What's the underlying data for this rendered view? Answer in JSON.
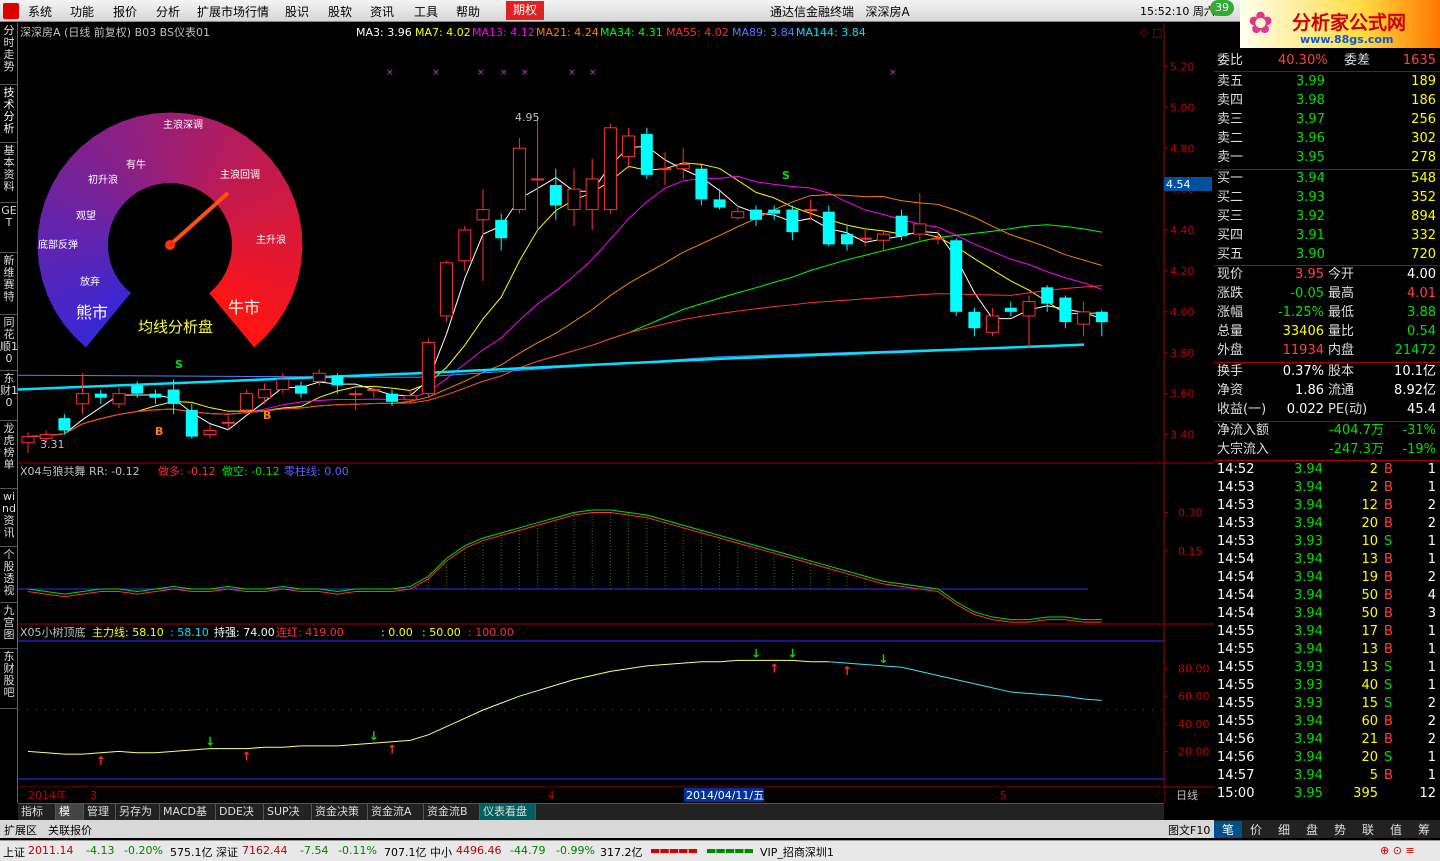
{
  "menu": {
    "items": [
      "系统",
      "功能",
      "报价",
      "分析",
      "扩展市场行情",
      "股识",
      "股软",
      "资讯",
      "工具",
      "帮助"
    ],
    "options_tab": "期权",
    "app_title": "通达信金融终端",
    "stock_name": "深深房A",
    "time": "15:52:10 周六",
    "badge": "39"
  },
  "brand": {
    "title": "分析家公式网",
    "url": "www.88gs.com"
  },
  "left_tabs": [
    "分时走势",
    "技术分析",
    "基本资料",
    "GET",
    "新维赛特",
    "同花顺10",
    "东财10",
    "龙虎榜单",
    "wind资讯",
    "个股透视",
    "九宫图",
    "东财股吧"
  ],
  "chart": {
    "header": "深深房A (日线 前复权) B03 BS仪表01",
    "ma_labels": [
      {
        "t": "MA3: 3.96",
        "c": "#ffffff"
      },
      {
        "t": "MA7: 4.02",
        "c": "#ffff00"
      },
      {
        "t": "MA13: 4.12",
        "c": "#ff00ff"
      },
      {
        "t": "MA21: 4.24",
        "c": "#ff8000"
      },
      {
        "t": "MA34: 4.31",
        "c": "#00ff00"
      },
      {
        "t": "MA55: 4.02",
        "c": "#ff3030"
      },
      {
        "t": "MA89: 3.84",
        "c": "#5080ff"
      },
      {
        "t": "MA144: 3.84",
        "c": "#00e0ff"
      }
    ],
    "price_ticks": [
      "5.20",
      "5.00",
      "4.80",
      "4.60",
      "4.40",
      "4.20",
      "4.00",
      "3.80",
      "3.60",
      "3.40"
    ],
    "current_price_tag": "4.54",
    "high_label": "4.95",
    "low_label": "3.31",
    "gauge": {
      "title": "均线分析盘",
      "labels": [
        "底部反弹",
        "观望",
        "初升浪",
        "有牛",
        "主浪深调",
        "主浪回调",
        "主升浪",
        "熊市",
        "牛市",
        "放弃"
      ]
    },
    "signals": [
      "S",
      "S",
      "B",
      "B"
    ],
    "ind1": {
      "header": "X04与狼共舞",
      "rr": "RR: -0.12",
      "a": "做多: -0.12",
      "b": "做空: -0.12",
      "c": "零柱线: 0.00",
      "ticks": [
        "0.30",
        "0.15"
      ]
    },
    "ind2": {
      "header": "X05小树顶底",
      "a": "主力线: 58.10",
      "b": ": 58.10",
      "c": "持强: 74.00",
      "d": "连红: 419.00",
      "e": ": 0.00",
      "f": ": 50.00",
      "g": ": 100.00",
      "ticks": [
        "80.00",
        "60.00",
        "40.00",
        "20.00"
      ]
    },
    "xaxis": {
      "year": "2014年",
      "m3": "3",
      "m4": "4",
      "date": "2014/04/11/五",
      "m5": "5",
      "period": "日线"
    }
  },
  "chart_data": {
    "type": "candlestick",
    "title": "深深房A (日线 前复权)",
    "ylim": [
      3.3,
      5.3
    ],
    "candles": [
      [
        3.36,
        3.39,
        3.41,
        3.31
      ],
      [
        3.38,
        3.4,
        3.42,
        3.36
      ],
      [
        3.48,
        3.42,
        3.5,
        3.4
      ],
      [
        3.55,
        3.6,
        3.7,
        3.5
      ],
      [
        3.6,
        3.58,
        3.62,
        3.55
      ],
      [
        3.55,
        3.6,
        3.63,
        3.53
      ],
      [
        3.64,
        3.6,
        3.66,
        3.58
      ],
      [
        3.6,
        3.58,
        3.62,
        3.55
      ],
      [
        3.62,
        3.55,
        3.67,
        3.5
      ],
      [
        3.52,
        3.39,
        3.55,
        3.38
      ],
      [
        3.4,
        3.42,
        3.45,
        3.38
      ],
      [
        3.46,
        3.46,
        3.5,
        3.42
      ],
      [
        3.52,
        3.6,
        3.62,
        3.5
      ],
      [
        3.58,
        3.62,
        3.65,
        3.55
      ],
      [
        3.62,
        3.67,
        3.7,
        3.6
      ],
      [
        3.64,
        3.6,
        3.66,
        3.58
      ],
      [
        3.66,
        3.7,
        3.72,
        3.64
      ],
      [
        3.69,
        3.64,
        3.7,
        3.6
      ],
      [
        3.6,
        3.6,
        3.62,
        3.52
      ],
      [
        3.62,
        3.62,
        3.64,
        3.58
      ],
      [
        3.6,
        3.56,
        3.62,
        3.54
      ],
      [
        3.57,
        3.59,
        3.62,
        3.55
      ],
      [
        3.6,
        3.85,
        3.87,
        3.58
      ],
      [
        3.98,
        4.24,
        4.25,
        3.95
      ],
      [
        4.25,
        4.4,
        4.42,
        4.2
      ],
      [
        4.45,
        4.5,
        4.6,
        4.15
      ],
      [
        4.45,
        4.36,
        4.48,
        4.3
      ],
      [
        4.5,
        4.8,
        4.85,
        4.48
      ],
      [
        4.65,
        4.65,
        4.95,
        4.4
      ],
      [
        4.62,
        4.52,
        4.7,
        4.45
      ],
      [
        4.5,
        4.6,
        4.7,
        4.42
      ],
      [
        4.5,
        4.65,
        4.75,
        4.4
      ],
      [
        4.5,
        4.9,
        4.92,
        4.48
      ],
      [
        4.76,
        4.86,
        4.9,
        4.7
      ],
      [
        4.87,
        4.67,
        4.9,
        4.65
      ],
      [
        4.7,
        4.7,
        4.78,
        4.62
      ],
      [
        4.7,
        4.72,
        4.8,
        4.65
      ],
      [
        4.7,
        4.55,
        4.72,
        4.52
      ],
      [
        4.55,
        4.51,
        4.6,
        4.5
      ],
      [
        4.46,
        4.49,
        4.52,
        4.45
      ],
      [
        4.5,
        4.45,
        4.52,
        4.42
      ],
      [
        4.5,
        4.48,
        4.52,
        4.45
      ],
      [
        4.5,
        4.39,
        4.52,
        4.35
      ],
      [
        4.5,
        4.5,
        4.55,
        4.45
      ],
      [
        4.49,
        4.33,
        4.52,
        4.32
      ],
      [
        4.38,
        4.33,
        4.42,
        4.3
      ],
      [
        4.36,
        4.36,
        4.4,
        4.32
      ],
      [
        4.35,
        4.38,
        4.4,
        4.3
      ],
      [
        4.47,
        4.37,
        4.5,
        4.35
      ],
      [
        4.38,
        4.43,
        4.58,
        4.35
      ],
      [
        4.36,
        4.36,
        4.4,
        4.33
      ],
      [
        4.35,
        4.0,
        4.36,
        3.98
      ],
      [
        4.0,
        3.92,
        4.02,
        3.88
      ],
      [
        3.9,
        3.98,
        4.02,
        3.88
      ],
      [
        4.02,
        4.0,
        4.05,
        3.98
      ],
      [
        3.98,
        4.05,
        4.08,
        3.82
      ],
      [
        4.12,
        4.04,
        4.13,
        4.0
      ],
      [
        4.07,
        3.95,
        4.08,
        3.92
      ],
      [
        3.94,
        4.0,
        4.05,
        3.88
      ],
      [
        4.0,
        3.95,
        4.01,
        3.88
      ]
    ]
  },
  "quote": {
    "ratio_label": "委比",
    "ratio": "40.30%",
    "diff_label": "委差",
    "diff": "1635",
    "asks": [
      {
        "l": "卖五",
        "p": "3.99",
        "v": "189"
      },
      {
        "l": "卖四",
        "p": "3.98",
        "v": "186"
      },
      {
        "l": "卖三",
        "p": "3.97",
        "v": "256"
      },
      {
        "l": "卖二",
        "p": "3.96",
        "v": "302"
      },
      {
        "l": "卖一",
        "p": "3.95",
        "v": "278"
      }
    ],
    "bids": [
      {
        "l": "买一",
        "p": "3.94",
        "v": "548"
      },
      {
        "l": "买二",
        "p": "3.93",
        "v": "352"
      },
      {
        "l": "买三",
        "p": "3.92",
        "v": "894"
      },
      {
        "l": "买四",
        "p": "3.91",
        "v": "332"
      },
      {
        "l": "买五",
        "p": "3.90",
        "v": "720"
      }
    ],
    "stats": [
      {
        "a": "现价",
        "av": "3.95",
        "ac": "#ff4040",
        "b": "今开",
        "bv": "4.00",
        "bc": "#ffffff"
      },
      {
        "a": "涨跌",
        "av": "-0.05",
        "ac": "#00e000",
        "b": "最高",
        "bv": "4.01",
        "bc": "#ff4040"
      },
      {
        "a": "涨幅",
        "av": "-1.25%",
        "ac": "#00e000",
        "b": "最低",
        "bv": "3.88",
        "bc": "#00e000"
      },
      {
        "a": "总量",
        "av": "33406",
        "ac": "#ffff00",
        "b": "量比",
        "bv": "0.54",
        "bc": "#00e000"
      },
      {
        "a": "外盘",
        "av": "11934",
        "ac": "#ff4040",
        "b": "内盘",
        "bv": "21472",
        "bc": "#00e000"
      }
    ],
    "stats2": [
      {
        "a": "换手",
        "av": "0.37%",
        "b": "股本",
        "bv": "10.1亿"
      },
      {
        "a": "净资",
        "av": "1.86",
        "b": "流通",
        "bv": "8.92亿"
      },
      {
        "a": "收益(一)",
        "av": "0.022",
        "b": "PE(动)",
        "bv": "45.4"
      }
    ],
    "flows": [
      {
        "l": "净流入额",
        "v": "-404.7万",
        "p": "-31%"
      },
      {
        "l": "大宗流入",
        "v": "-247.3万",
        "p": "-19%"
      }
    ],
    "ticks": [
      {
        "t": "14:52",
        "p": "3.94",
        "v": "2",
        "s": "B",
        "n": "1"
      },
      {
        "t": "14:53",
        "p": "3.94",
        "v": "2",
        "s": "B",
        "n": "1"
      },
      {
        "t": "14:53",
        "p": "3.94",
        "v": "12",
        "s": "B",
        "n": "2"
      },
      {
        "t": "14:53",
        "p": "3.94",
        "v": "20",
        "s": "B",
        "n": "2"
      },
      {
        "t": "14:53",
        "p": "3.93",
        "v": "10",
        "s": "S",
        "n": "1"
      },
      {
        "t": "14:54",
        "p": "3.94",
        "v": "13",
        "s": "B",
        "n": "1"
      },
      {
        "t": "14:54",
        "p": "3.94",
        "v": "19",
        "s": "B",
        "n": "2"
      },
      {
        "t": "14:54",
        "p": "3.94",
        "v": "50",
        "s": "B",
        "n": "4"
      },
      {
        "t": "14:54",
        "p": "3.94",
        "v": "50",
        "s": "B",
        "n": "3"
      },
      {
        "t": "14:55",
        "p": "3.94",
        "v": "17",
        "s": "B",
        "n": "1"
      },
      {
        "t": "14:55",
        "p": "3.94",
        "v": "13",
        "s": "B",
        "n": "1"
      },
      {
        "t": "14:55",
        "p": "3.93",
        "v": "13",
        "s": "S",
        "n": "1"
      },
      {
        "t": "14:55",
        "p": "3.93",
        "v": "40",
        "s": "S",
        "n": "1"
      },
      {
        "t": "14:55",
        "p": "3.93",
        "v": "15",
        "s": "S",
        "n": "2"
      },
      {
        "t": "14:55",
        "p": "3.94",
        "v": "60",
        "s": "B",
        "n": "2"
      },
      {
        "t": "14:56",
        "p": "3.94",
        "v": "21",
        "s": "B",
        "n": "2"
      },
      {
        "t": "14:56",
        "p": "3.94",
        "v": "20",
        "s": "S",
        "n": "1"
      },
      {
        "t": "14:57",
        "p": "3.94",
        "v": "5",
        "s": "B",
        "n": "1"
      },
      {
        "t": "15:00",
        "p": "3.95",
        "v": "395",
        "s": "",
        "n": "12"
      }
    ]
  },
  "bottom_tabs": [
    "指标",
    "模板",
    "管理",
    "另存为",
    "MACD基本",
    "DDE决策",
    "SUP决策",
    "资金决策",
    "资金流A",
    "资金流B",
    "仪表看盘"
  ],
  "row2": {
    "a": "扩展区",
    "b": "关联报价",
    "c": "图文F10"
  },
  "right_tabs": [
    "笔",
    "价",
    "细",
    "盘",
    "势",
    "联",
    "值",
    "筹"
  ],
  "status": {
    "sh": "上证",
    "sh_v": "2011.14",
    "sh_c": "-4.13",
    "sh_p": "-0.20%",
    "sh_a": "575.1亿",
    "sz": "深证",
    "sz_v": "7162.44",
    "sz_c": "-7.54",
    "sz_p": "-0.11%",
    "sz_a": "707.1亿",
    "zx": "中小",
    "zx_v": "4496.46",
    "zx_c": "-44.79",
    "zx_p": "-0.99%",
    "zx_a": "317.2亿",
    "vip": "VIP_招商深圳1"
  }
}
